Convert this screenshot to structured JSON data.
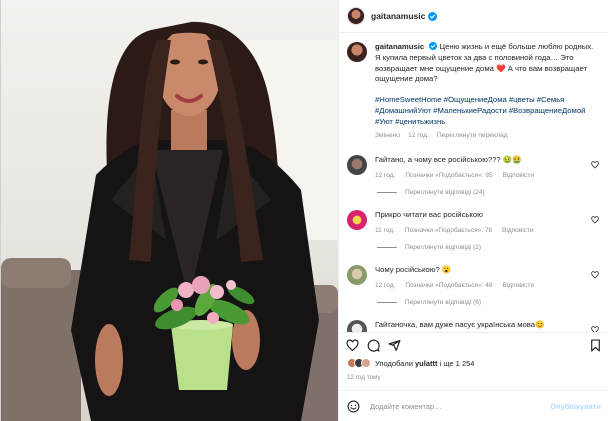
{
  "post": {
    "username": "gaitanamusic",
    "verified": true
  },
  "caption": {
    "username": "gaitanamusic",
    "text": "Ценю жизнь и ещё больше люблю родных. Я купила первый цветок за два с половиной года… Это возвращает мне ощущение дома ❤️ А что вам возвращает ощущение дома?",
    "hashtags": "#HomeSweetHome #ОщущениеДома #цветы #Семья #ДомашнийУют #МаленькиеРадости #ВозвращениеДомой #Уют #ценитьжизнь",
    "edited_label": "Змінено",
    "time": "12 год.",
    "translate": "Переглянути переклад"
  },
  "comments": [
    {
      "text": "Гайтано, а чому все російською??? 🤢🤮",
      "time": "12 год.",
      "likes": "Позначки «Подобається»: 95",
      "reply": "Відповісти",
      "view_replies": "Переглянути відповіді (24)",
      "avatar_color": "#4a4a4a"
    },
    {
      "text": "Прикро читати вас російською",
      "time": "11 год.",
      "likes": "Позначки «Подобається»: 78",
      "reply": "Відповісти",
      "view_replies": "Переглянути відповіді (2)",
      "avatar_color": "#d6246e"
    },
    {
      "text": "Чому російською? 😮",
      "time": "12 год.",
      "likes": "Позначки «Подобається»: 48",
      "reply": "Відповісти",
      "view_replies": "Переглянути відповіді (6)",
      "avatar_color": "#a4b08a"
    },
    {
      "text": "Гайтаночка, вам дуже пасує українська мова😊",
      "avatar_color": "#cfcfd4"
    }
  ],
  "likes": {
    "prefix": "Уподобали",
    "user": "yulattt",
    "rest": "і ще 1 254"
  },
  "post_time": "12 год тому",
  "add_comment": {
    "placeholder": "Додайте коментар…",
    "publish": "Опублікувати"
  },
  "icons": {
    "like": "heart-icon",
    "comment": "comment-icon",
    "share": "share-icon",
    "save": "bookmark-icon",
    "emoji": "emoji-icon"
  },
  "colors": {
    "verified": "#0095f6",
    "hashtag": "#00376b",
    "muted": "#8e8e8e",
    "publish_disabled": "#b3dbff"
  }
}
